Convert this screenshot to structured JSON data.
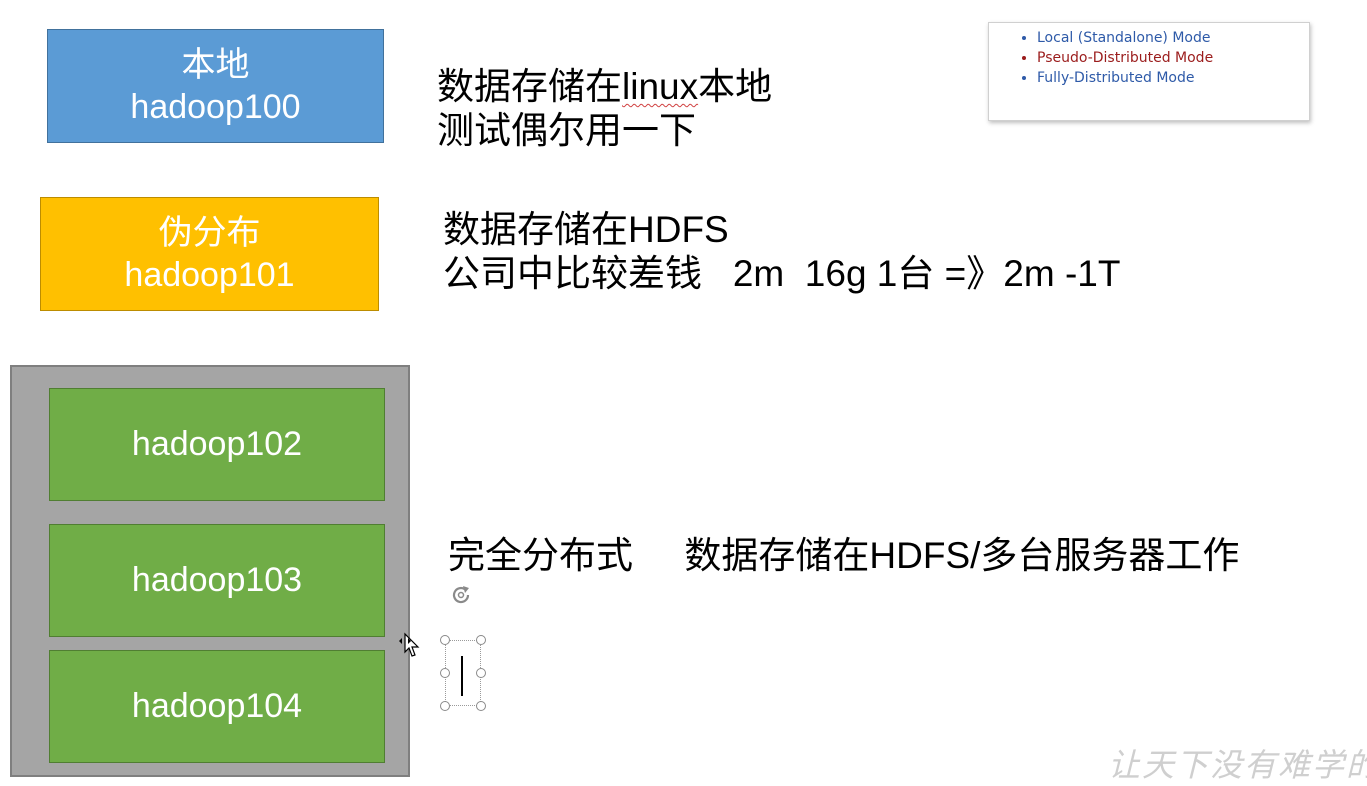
{
  "boxes": {
    "local": {
      "title": "本地",
      "host": "hadoop100",
      "color": "#5b9bd5"
    },
    "pseudo": {
      "title": "伪分布",
      "host": "hadoop101",
      "color": "#ffc000"
    }
  },
  "cluster": {
    "nodes": [
      "hadoop102",
      "hadoop103",
      "hadoop104"
    ],
    "node_color": "#70ad47",
    "frame_color": "#a5a5a5"
  },
  "descriptions": {
    "local": {
      "line1_prefix": "数据存储在",
      "line1_word": "linux",
      "line1_suffix": "本地",
      "line2": "测试偶尔用一下"
    },
    "pseudo": {
      "line1": "数据存储在HDFS",
      "line2": "公司中比较差钱   2m  16g 1台 =》2m -1T"
    },
    "fully": {
      "line1": "完全分布式     数据存储在HDFS/多台服务器工作"
    }
  },
  "modes": [
    {
      "label": "Local (Standalone) Mode",
      "color": "#2e5aa8"
    },
    {
      "label": "Pseudo-Distributed Mode",
      "color": "#9b1c1c"
    },
    {
      "label": "Fully-Distributed Mode",
      "color": "#2e5aa8"
    }
  ],
  "watermark": "让天下没有难学的"
}
